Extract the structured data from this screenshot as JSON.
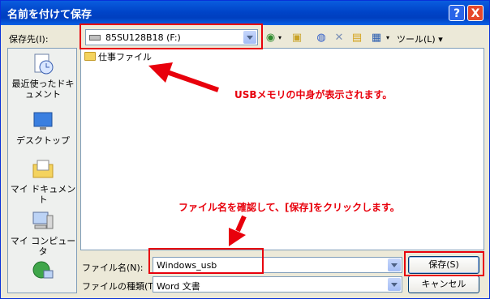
{
  "window": {
    "title": "名前を付けて保存",
    "help_button": "?",
    "close_button": "X"
  },
  "location": {
    "label": "保存先(I):",
    "value": "85SU128B18 (F:)"
  },
  "toolbar": {
    "tools_label": "ツール(L)"
  },
  "places": [
    {
      "label": "最近使ったドキュメント",
      "icon": "recent-documents-icon"
    },
    {
      "label": "デスクトップ",
      "icon": "desktop-icon"
    },
    {
      "label": "マイ ドキュメント",
      "icon": "my-documents-icon"
    },
    {
      "label": "マイ コンピュータ",
      "icon": "my-computer-icon"
    }
  ],
  "files": [
    {
      "name": "仕事ファイル",
      "type": "folder"
    }
  ],
  "filename": {
    "label": "ファイル名(N):",
    "value": "Windows_usb"
  },
  "filetype": {
    "label": "ファイルの種類(T):",
    "value": "Word 文書"
  },
  "buttons": {
    "save": "保存(S)",
    "cancel": "キャンセル"
  },
  "annotations": {
    "note1": "USBメモリの中身が表示されます。",
    "note2": "ファイル名を確認して、[保存]をクリックします。"
  },
  "colors": {
    "annotation_red": "#e8000c",
    "title_blue": "#0a5ddf"
  }
}
